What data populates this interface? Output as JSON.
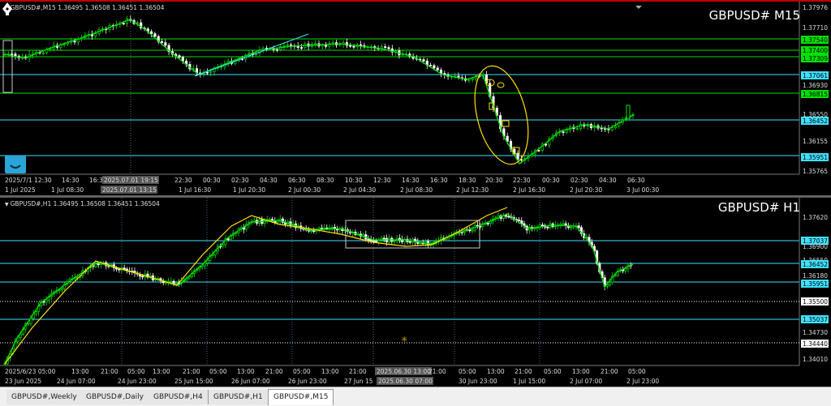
{
  "m15": {
    "ohlc_text": "GBPUSD#,M15 1.36495 1.36508 1.36451 1.36504",
    "symbol": "GBPUSD# M15",
    "price_ticks": [
      "1.37976",
      "1.37710",
      "1.37540",
      "1.37400",
      "1.37309",
      "1.37061",
      "1.36930",
      "1.36815",
      "1.36550",
      "1.36452",
      "1.36155",
      "1.35951",
      "1.35765"
    ],
    "price_tick_colors": [
      "#c8c8c8",
      "#c8c8c8",
      "#00e000",
      "#00e000",
      "#00e000",
      "#40e0ff",
      "#c8c8c8",
      "#00e000",
      "#c8c8c8",
      "#40e0ff",
      "#c8c8c8",
      "#40e0ff",
      "#c8c8c8"
    ],
    "time_labels": [
      "2025/7/1 12:30",
      "14:30",
      "16:3",
      "2025.07.01 19:15",
      "22:30",
      "00:30",
      "02:30",
      "04:30",
      "06:30",
      "08:30",
      "10:30",
      "12:30",
      "14:30",
      "16:30",
      "18:30",
      "20:30",
      "22:30",
      "00:30",
      "02:30",
      "04:30",
      "06:30"
    ],
    "date_labels": [
      "1 Jul 2025",
      "1 Jul 08:30",
      "2025.07.01 13:15",
      "1 Jul 16:30",
      "1 Jul 20:30",
      "2 Jul 00:30",
      "2 Jul 04:30",
      "2 Jul 08:30",
      "2 Jul 12:30",
      "2 Jul 16:30",
      "2 Jul 20:30",
      "3 Jul 00:30"
    ]
  },
  "h1": {
    "ohlc_text": "GBPUSD#,H1 1.36495 1.36508 1.36451 1.36504",
    "symbol": "GBPUSD# H1",
    "price_ticks": [
      "1.37620",
      "1.37037",
      "1.36900",
      "1.36550",
      "1.36452",
      "1.36180",
      "1.35951",
      "1.35500",
      "1.35037",
      "1.34730",
      "1.34440",
      "1.34010"
    ],
    "price_tick_colors": [
      "#c8c8c8",
      "#40e0ff",
      "#c8c8c8",
      "#c8c8c8",
      "#40e0ff",
      "#c8c8c8",
      "#40e0ff",
      "#ffffff",
      "#40e0ff",
      "#c8c8c8",
      "#ffffff",
      "#c8c8c8"
    ],
    "time_labels": [
      "2025/6/23 05:00",
      "13:00",
      "21:00",
      "05:00",
      "13:00",
      "21:00",
      "05:00",
      "13:00",
      "21:00",
      "05:00",
      "13:00",
      "21:00",
      "2025.06.30 13:00",
      "21:00",
      "05:00",
      "13:00",
      "21:00",
      "05:00",
      "13:00",
      "21:00",
      "05:00"
    ],
    "date_labels": [
      "23 Jun 2025",
      "24 Jun 07:00",
      "24 Jun 23:00",
      "25 Jun 15:00",
      "26 Jun 07:00",
      "26 Jun 23:00",
      "27 Jun 15",
      "2025.06.30 07:00",
      "30 Jun 23:00",
      "1 Jul 15:00",
      "2 Jul 07:00",
      "2 Jul 23:00"
    ]
  },
  "tabs": [
    "GBPUSD#,Weekly",
    "GBPUSD#,Daily",
    "GBPUSD#,H4",
    "GBPUSD#,H1",
    "GBPUSD#,M15"
  ],
  "active_tab": "GBPUSD#,M15",
  "colors": {
    "bull": "#00e000",
    "bear": "#ffffff",
    "support": "#40e0ff",
    "resist": "#00e000",
    "trend": "#ffe000"
  }
}
